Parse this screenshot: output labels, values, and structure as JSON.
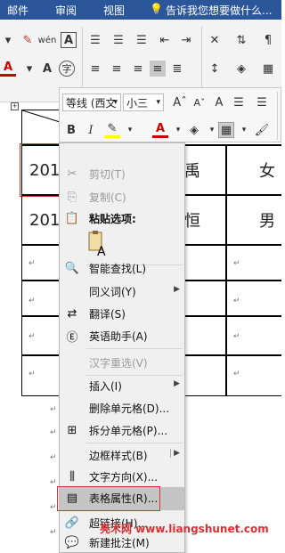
{
  "ribbon_tabs": [
    "邮件",
    "审阅",
    "视图"
  ],
  "tell_me": "告诉我您想要做什么...",
  "mini_toolbar": {
    "font_name": "等线 (西文",
    "font_size": "小三",
    "bold": "B",
    "italic": "I",
    "font_color_glyph": "A",
    "shading_glyph": "A"
  },
  "table": {
    "row1": [
      "201",
      "禹",
      "女"
    ],
    "row2": [
      "201",
      "恒",
      "男"
    ]
  },
  "context_menu": {
    "cut": "剪切(T)",
    "copy": "复制(C)",
    "paste_options": "粘贴选项:",
    "smart_lookup": "智能查找(L)",
    "synonyms": "同义词(Y)",
    "translate": "翻译(S)",
    "english_assistant": "英语助手(A)",
    "hanzi_reselect": "汉字重选(V)",
    "insert": "插入(I)",
    "delete_cells": "删除单元格(D)...",
    "split_cells": "拆分单元格(P)...",
    "border_styles": "边框样式(B)",
    "text_direction": "文字方向(X)...",
    "table_properties": "表格属性(R)...",
    "hyperlink": "超链接(H)...",
    "new_comment": "新建批注(M)"
  },
  "watermark": "亮术网 www.liangshunet.com",
  "colors": {
    "ribbon_blue": "#2b579a",
    "highlight_red": "#d93131",
    "hover_gray": "#c5c5c5"
  }
}
